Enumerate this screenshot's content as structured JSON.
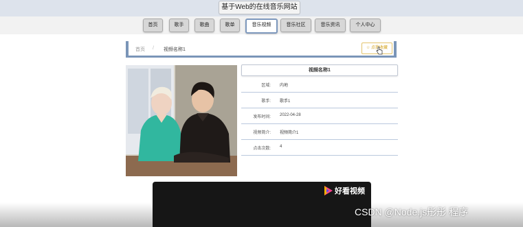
{
  "site": {
    "title": "基于Web的在线音乐网站"
  },
  "nav": {
    "items": [
      {
        "label": "首页"
      },
      {
        "label": "歌手"
      },
      {
        "label": "歌曲"
      },
      {
        "label": "歌单"
      },
      {
        "label": "音乐视频"
      },
      {
        "label": "音乐社区"
      },
      {
        "label": "音乐资讯"
      },
      {
        "label": "个人中心"
      }
    ],
    "active_index": 4
  },
  "breadcrumb": {
    "home": "首页",
    "separator": "/",
    "current": "视频名称1"
  },
  "favorite_button": {
    "label": "☆ 点我收藏"
  },
  "detail": {
    "title": "视频名称1",
    "rows": [
      {
        "label": "区域:",
        "value": "内地"
      },
      {
        "label": "歌手:",
        "value": "歌手1"
      },
      {
        "label": "发布时间:",
        "value": "2022-04-28"
      },
      {
        "label": "视频简介:",
        "value": "视频简介1"
      },
      {
        "label": "点击次数:",
        "value": "4"
      }
    ]
  },
  "player": {
    "brand": "好看视频"
  },
  "watermark": {
    "text": "CSDN @Node.js彤彤 程序"
  },
  "colors": {
    "accent": "#7a95b8",
    "favorite": "#d4a21c"
  }
}
